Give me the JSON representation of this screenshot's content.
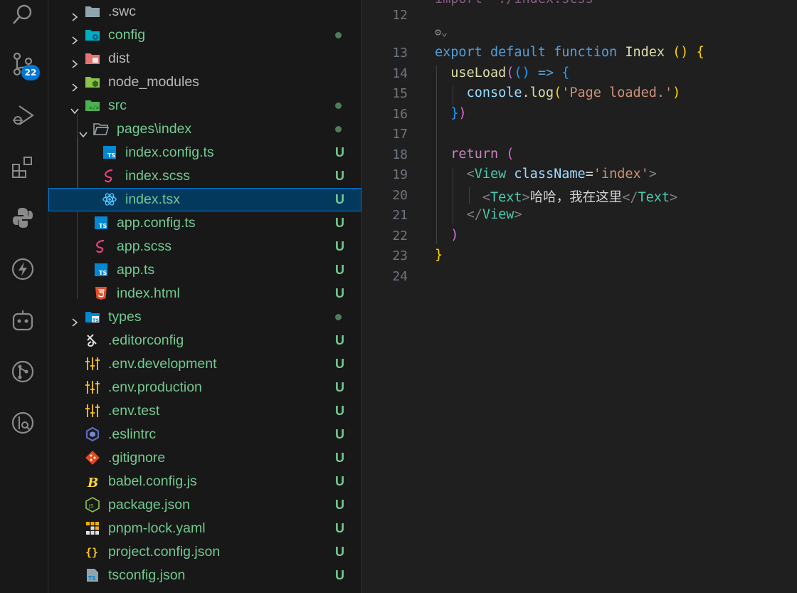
{
  "activity_bar": {
    "items": [
      "search-icon",
      "source-control-icon",
      "run-debug-icon",
      "extensions-icon",
      "python-icon",
      "lightning-icon",
      "copilot-icon",
      "git-graph-icon",
      "git-lens-icon"
    ],
    "source_control_badge": "22"
  },
  "explorer": {
    "rows": [
      {
        "label": ".swc",
        "color": "gray",
        "icon": "folder-icon",
        "chevron": "right",
        "depth": 0,
        "status": ""
      },
      {
        "label": "config",
        "color": "green",
        "icon": "folder-config-icon",
        "chevron": "right",
        "depth": 0,
        "status": "dot"
      },
      {
        "label": "dist",
        "color": "gray",
        "icon": "folder-dist-icon",
        "chevron": "right",
        "depth": 0,
        "status": ""
      },
      {
        "label": "node_modules",
        "color": "gray",
        "icon": "folder-node-icon",
        "chevron": "right",
        "depth": 0,
        "status": ""
      },
      {
        "label": "src",
        "color": "green",
        "icon": "folder-src-icon",
        "chevron": "down",
        "depth": 0,
        "status": "dot"
      },
      {
        "label": "pages\\index",
        "color": "green",
        "icon": "folder-open-icon",
        "chevron": "down",
        "depth": 1,
        "status": "dot"
      },
      {
        "label": "index.config.ts",
        "color": "green",
        "icon": "typescript-icon",
        "chevron": "",
        "depth": 2,
        "status": "U"
      },
      {
        "label": "index.scss",
        "color": "green",
        "icon": "sass-icon",
        "chevron": "",
        "depth": 2,
        "status": "U"
      },
      {
        "label": "index.tsx",
        "color": "green",
        "icon": "react-icon",
        "chevron": "",
        "depth": 2,
        "status": "U",
        "selected": true
      },
      {
        "label": "app.config.ts",
        "color": "green",
        "icon": "typescript-icon",
        "chevron": "",
        "depth": 1,
        "status": "U"
      },
      {
        "label": "app.scss",
        "color": "green",
        "icon": "sass-icon",
        "chevron": "",
        "depth": 1,
        "status": "U"
      },
      {
        "label": "app.ts",
        "color": "green",
        "icon": "typescript-icon",
        "chevron": "",
        "depth": 1,
        "status": "U"
      },
      {
        "label": "index.html",
        "color": "green",
        "icon": "html-icon",
        "chevron": "",
        "depth": 1,
        "status": "U"
      },
      {
        "label": "types",
        "color": "green",
        "icon": "folder-types-icon",
        "chevron": "right",
        "depth": 0,
        "status": "dot"
      },
      {
        "label": ".editorconfig",
        "color": "green",
        "icon": "editorconfig-icon",
        "chevron": "",
        "depth": 0,
        "status": "U"
      },
      {
        "label": ".env.development",
        "color": "green",
        "icon": "env-icon",
        "chevron": "",
        "depth": 0,
        "status": "U"
      },
      {
        "label": ".env.production",
        "color": "green",
        "icon": "env-icon",
        "chevron": "",
        "depth": 0,
        "status": "U"
      },
      {
        "label": ".env.test",
        "color": "green",
        "icon": "env-icon",
        "chevron": "",
        "depth": 0,
        "status": "U"
      },
      {
        "label": ".eslintrc",
        "color": "green",
        "icon": "eslint-icon",
        "chevron": "",
        "depth": 0,
        "status": "U"
      },
      {
        "label": ".gitignore",
        "color": "green",
        "icon": "git-icon",
        "chevron": "",
        "depth": 0,
        "status": "U"
      },
      {
        "label": "babel.config.js",
        "color": "green",
        "icon": "babel-icon",
        "chevron": "",
        "depth": 0,
        "status": "U"
      },
      {
        "label": "package.json",
        "color": "green",
        "icon": "nodejs-icon",
        "chevron": "",
        "depth": 0,
        "status": "U"
      },
      {
        "label": "pnpm-lock.yaml",
        "color": "green",
        "icon": "pnpm-icon",
        "chevron": "",
        "depth": 0,
        "status": "U"
      },
      {
        "label": "project.config.json",
        "color": "green",
        "icon": "json-icon",
        "chevron": "",
        "depth": 0,
        "status": "U"
      },
      {
        "label": "tsconfig.json",
        "color": "green",
        "icon": "tsconfig-icon",
        "chevron": "",
        "depth": 0,
        "status": "U"
      }
    ]
  },
  "editor": {
    "line_numbers": [
      "12",
      "13",
      "14",
      "15",
      "16",
      "17",
      "18",
      "19",
      "20",
      "21",
      "22",
      "23",
      "24"
    ],
    "code": {
      "l13_export": "export",
      "l13_default": "default",
      "l13_function": "function",
      "l13_name": "Index",
      "l13_paren": "()",
      "l13_brace": "{",
      "l14_fn": "useLoad",
      "l14_open": "(",
      "l14_args": "()",
      "l14_arrow": "=>",
      "l14_brace": "{",
      "l15_obj": "console",
      "l15_dot": ".",
      "l15_fn": "log",
      "l15_open": "(",
      "l15_str": "'Page loaded.'",
      "l15_close": ")",
      "l16_brace": "}",
      "l16_close": ")",
      "l18_return": "return",
      "l18_open": "(",
      "l19_lt": "<",
      "l19_tag": "View",
      "l19_attr": "className",
      "l19_eq": "=",
      "l19_val": "'index'",
      "l19_gt": ">",
      "l20_lt": "<",
      "l20_tag": "Text",
      "l20_gt": ">",
      "l20_text": "哈哈，我在这里",
      "l20_close_lt": "</",
      "l20_close_tag": "Text",
      "l20_close_gt": ">",
      "l21_lt": "</",
      "l21_tag": "View",
      "l21_gt": ">",
      "l22_close": ")",
      "l23_brace": "}"
    }
  }
}
